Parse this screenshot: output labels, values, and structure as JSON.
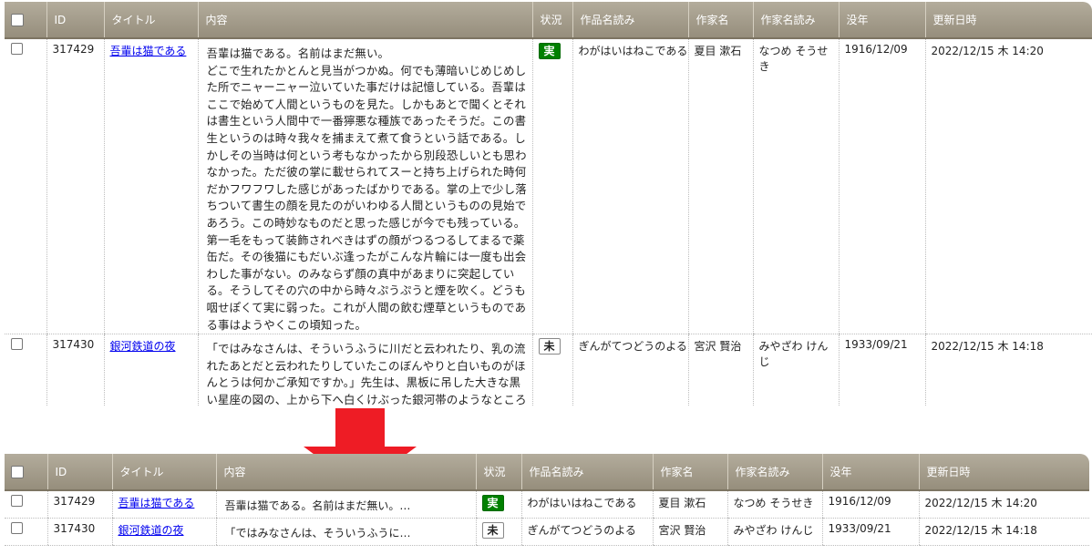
{
  "headers": {
    "id": "ID",
    "title": "タイトル",
    "content": "内容",
    "status": "状況",
    "title_reading": "作品名読み",
    "author": "作家名",
    "author_reading": "作家名読み",
    "death_year": "没年",
    "updated": "更新日時"
  },
  "rows": [
    {
      "id": "317429",
      "title": "吾輩は猫である",
      "content_full": "吾輩は猫である。名前はまだ無い。\nどこで生れたかとんと見当がつかぬ。何でも薄暗いじめじめした所でニャーニャー泣いていた事だけは記憶している。吾輩はここで始めて人間というものを見た。しかもあとで聞くとそれは書生という人間中で一番獰悪な種族であったそうだ。この書生というのは時々我々を捕まえて煮て食うという話である。しかしその当時は何という考もなかったから別段恐しいとも思わなかった。ただ彼の掌に載せられてスーと持ち上げられた時何だかフワフワした感じがあったばかりである。掌の上で少し落ちついて書生の顔を見たのがいわゆる人間というものの見始であろう。この時妙なものだと思った感じが今でも残っている。第一毛をもって装飾されべきはずの顔がつるつるしてまるで薬缶だ。その後猫にもだいぶ逢ったがこんな片輪には一度も出会わした事がない。のみならず顔の真中があまりに突起している。そうしてその穴の中から時々ぷうぷうと煙を吹く。どうも咽せぽくて実に弱った。これが人間の飲む煙草というものである事はようやくこの頃知った。",
      "content_short": "吾輩は猫である。名前はまだ無い。…",
      "status": "実",
      "title_reading": "わがはいはねこである",
      "author": "夏目 漱石",
      "author_reading": "なつめ そうせき",
      "death_year": "1916/12/09",
      "updated": "2022/12/15 木 14:20"
    },
    {
      "id": "317430",
      "title": "銀河鉄道の夜",
      "content_full": "「ではみなさんは、そういうふうに川だと云われたり、乳の流れたあとだと云われたりしていたこのぼんやりと白いものがほんとうは何かご承知ですか。」先生は、黒板に吊した大きな黒い星座の図の、上から下へ白くけぶった銀河帯のようなところを指しながら、みんなに問をかけました。",
      "content_short": "「ではみなさんは、そういうふうに…",
      "status": "未",
      "title_reading": "ぎんがてつどうのよる",
      "author": "宮沢 賢治",
      "author_reading": "みやざわ けんじ",
      "death_year": "1933/09/21",
      "updated": "2022/12/15 木 14:18"
    }
  ],
  "colors": {
    "header_top": "#b3ac9c",
    "header_bottom": "#968e7c",
    "badge_done": "#008000",
    "arrow": "#ee1c25"
  }
}
